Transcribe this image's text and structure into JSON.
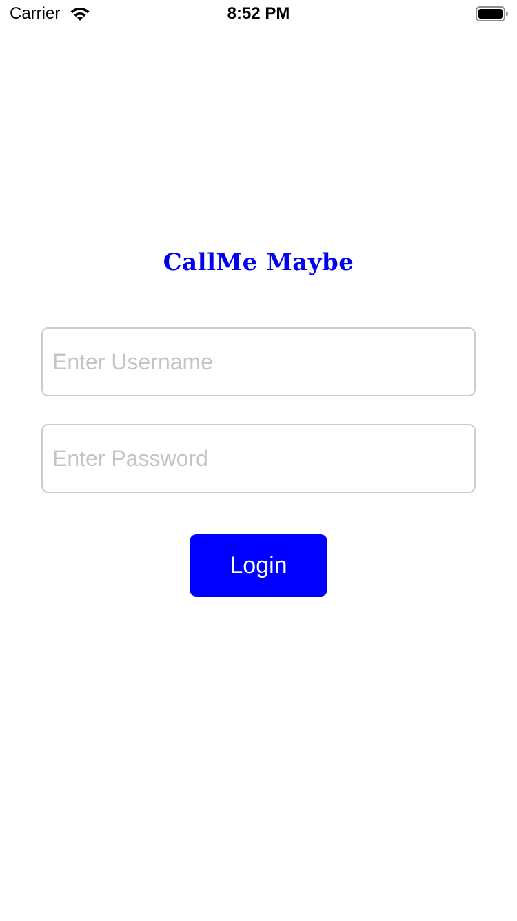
{
  "status_bar": {
    "carrier": "Carrier",
    "time": "8:52 PM",
    "wifi_icon": "wifi-icon",
    "battery_icon": "battery-icon"
  },
  "app": {
    "title": "CallMe Maybe",
    "title_color": "#0000ee"
  },
  "form": {
    "username_placeholder": "Enter Username",
    "username_value": "",
    "password_placeholder": "Enter Password",
    "password_value": "",
    "login_label": "Login",
    "login_color": "#0000ff"
  }
}
